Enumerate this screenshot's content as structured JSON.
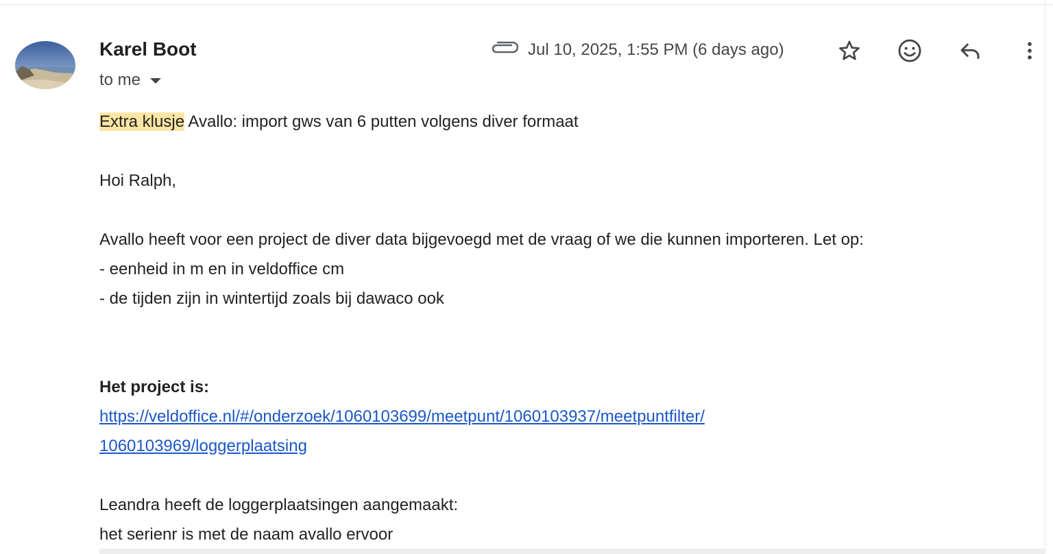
{
  "sender": {
    "name": "Karel Boot",
    "recipient_label": "to me",
    "avatar": "beach-photo-avatar"
  },
  "header": {
    "timestamp": "Jul 10, 2025, 1:55 PM (6 days ago)",
    "icons": [
      "paperclip-icon",
      "star-icon",
      "emoji-icon",
      "reply-icon",
      "more-vert-icon"
    ]
  },
  "message": {
    "subject_highlight": "Extra klusje",
    "subject_rest": " Avallo: import gws van 6 putten volgens diver formaat",
    "greeting": "Hoi Ralph,",
    "intro": "Avallo heeft voor een project de diver data bijgevoegd met de vraag of we die kunnen importeren. Let op:",
    "bullet_1": "- eenheid in m en in veldoffice cm",
    "bullet_2": "- de tijden zijn in wintertijd zoals bij dawaco ook",
    "project_heading": "Het project is:",
    "project_link_line1": "https://veldoffice.nl/#/onderzoek/1060103699/meetpunt/1060103937/meetpuntfilter/",
    "project_link_line2": "1060103969/loggerplaatsing",
    "leandra_line": "Leandra heeft de loggerplaatsingen aangemaakt:",
    "serial_line": "het serienr is met de naam avallo ervoor"
  },
  "colors": {
    "highlight": "#fbe5a3",
    "link": "#1a57c7",
    "text": "#222222",
    "secondary": "#444746"
  }
}
